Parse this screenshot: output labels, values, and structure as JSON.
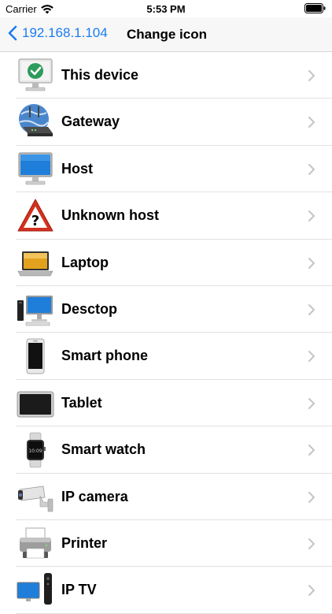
{
  "status": {
    "carrier": "Carrier",
    "time": "5:53 PM"
  },
  "nav": {
    "back_label": "192.168.1.104",
    "title": "Change icon"
  },
  "items": [
    {
      "label": "This device",
      "icon": "monitor-check-icon"
    },
    {
      "label": "Gateway",
      "icon": "gateway-router-icon"
    },
    {
      "label": "Host",
      "icon": "monitor-icon"
    },
    {
      "label": "Unknown host",
      "icon": "warning-question-icon"
    },
    {
      "label": "Laptop",
      "icon": "laptop-icon"
    },
    {
      "label": "Desctop",
      "icon": "desktop-icon"
    },
    {
      "label": "Smart phone",
      "icon": "smartphone-icon"
    },
    {
      "label": "Tablet",
      "icon": "tablet-icon"
    },
    {
      "label": "Smart watch",
      "icon": "smartwatch-icon"
    },
    {
      "label": "IP camera",
      "icon": "ip-camera-icon"
    },
    {
      "label": "Printer",
      "icon": "printer-icon"
    },
    {
      "label": "IP TV",
      "icon": "ip-tv-icon"
    }
  ],
  "colors": {
    "accent": "#1a7cf0",
    "separator": "#e1e1e1",
    "nav_bg": "#f7f7f7"
  }
}
